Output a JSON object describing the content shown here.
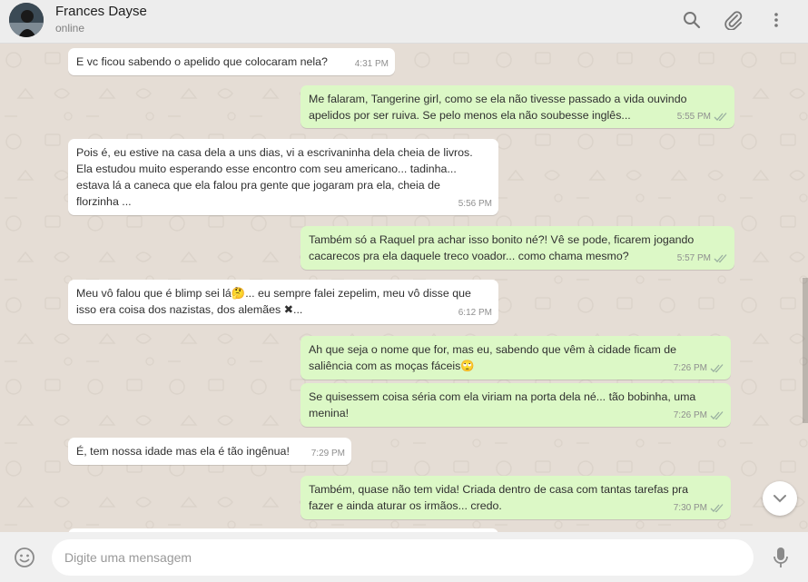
{
  "header": {
    "contact_name": "Frances Dayse",
    "status": "online",
    "icons": [
      "search-icon",
      "attach-icon",
      "menu-icon"
    ]
  },
  "messages": [
    {
      "dir": "in",
      "text": "E vc ficou sabendo o apelido que colocaram nela?",
      "time": "4:31 PM"
    },
    {
      "dir": "out",
      "text": "Me falaram, Tangerine girl, como se ela não tivesse passado a vida ouvindo apelidos por ser ruiva. Se pelo menos ela não soubesse inglês...",
      "time": "5:55 PM"
    },
    {
      "dir": "in",
      "text": "Pois é, eu estive na casa dela a uns dias, vi a escrivaninha dela cheia de livros. Ela estudou muito esperando esse encontro com seu americano... tadinha... estava lá a caneca que ela falou pra gente que jogaram pra ela, cheia de florzinha ...",
      "time": "5:56 PM"
    },
    {
      "dir": "out",
      "text": "Também só a Raquel pra achar isso bonito né?! Vê se pode, ficarem jogando cacarecos pra ela daquele treco voador... como chama mesmo?",
      "time": "5:57 PM"
    },
    {
      "dir": "in",
      "text": "Meu vô falou que é blimp sei lá🤔... eu sempre falei zepelim, meu vô disse que isso era coisa dos nazistas, dos alemães ✖...",
      "time": "6:12 PM"
    },
    {
      "dir": "out",
      "text": "Ah que seja o nome que for, mas eu, sabendo que vêm à cidade ficam de saliência com as moças fáceis🙄",
      "time": "7:26 PM"
    },
    {
      "dir": "out",
      "text": "Se quisessem coisa séria com ela viriam na porta dela né... tão bobinha, uma menina!",
      "time": "7:26 PM"
    },
    {
      "dir": "in",
      "text": "É, tem nossa idade mas ela é tão ingênua!",
      "time": "7:29 PM"
    },
    {
      "dir": "out",
      "text": "Também, quase não tem vida! Criada dentro de casa com tantas tarefas pra fazer e ainda aturar os irmãos... credo.",
      "time": "7:30 PM"
    }
  ],
  "composer": {
    "placeholder": "Digite uma mensagem",
    "value": ""
  },
  "colors": {
    "incoming_bubble": "#ffffff",
    "outgoing_bubble": "#dcf8c6",
    "chat_background": "#e5ddd5",
    "header_background": "#ededed"
  }
}
